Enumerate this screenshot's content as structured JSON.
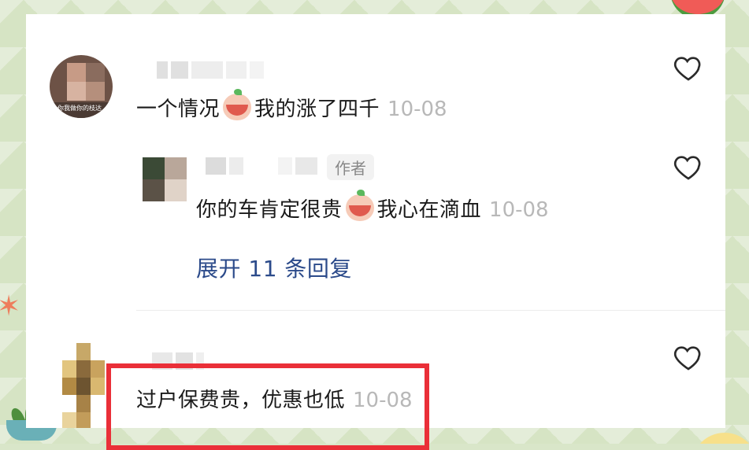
{
  "comments": [
    {
      "text": "一个情况",
      "text_after": "我的涨了四千",
      "time": "10-08",
      "avatar_caption": "你我做你的枝达"
    },
    {
      "author_tag": "作者",
      "text": "你的车肯定很贵",
      "text_after": "我心在滴血",
      "time": "10-08",
      "expand_label": "展开 11 条回复"
    },
    {
      "text": "过户保费贵，优惠也低",
      "time": "10-08"
    }
  ],
  "icons": {
    "like": "heart-outline-icon",
    "emoji": "crying-face-emoji"
  },
  "colors": {
    "link": "#2b4a8a",
    "highlight": "#ea2f38",
    "timestamp": "#b8b8b8"
  }
}
